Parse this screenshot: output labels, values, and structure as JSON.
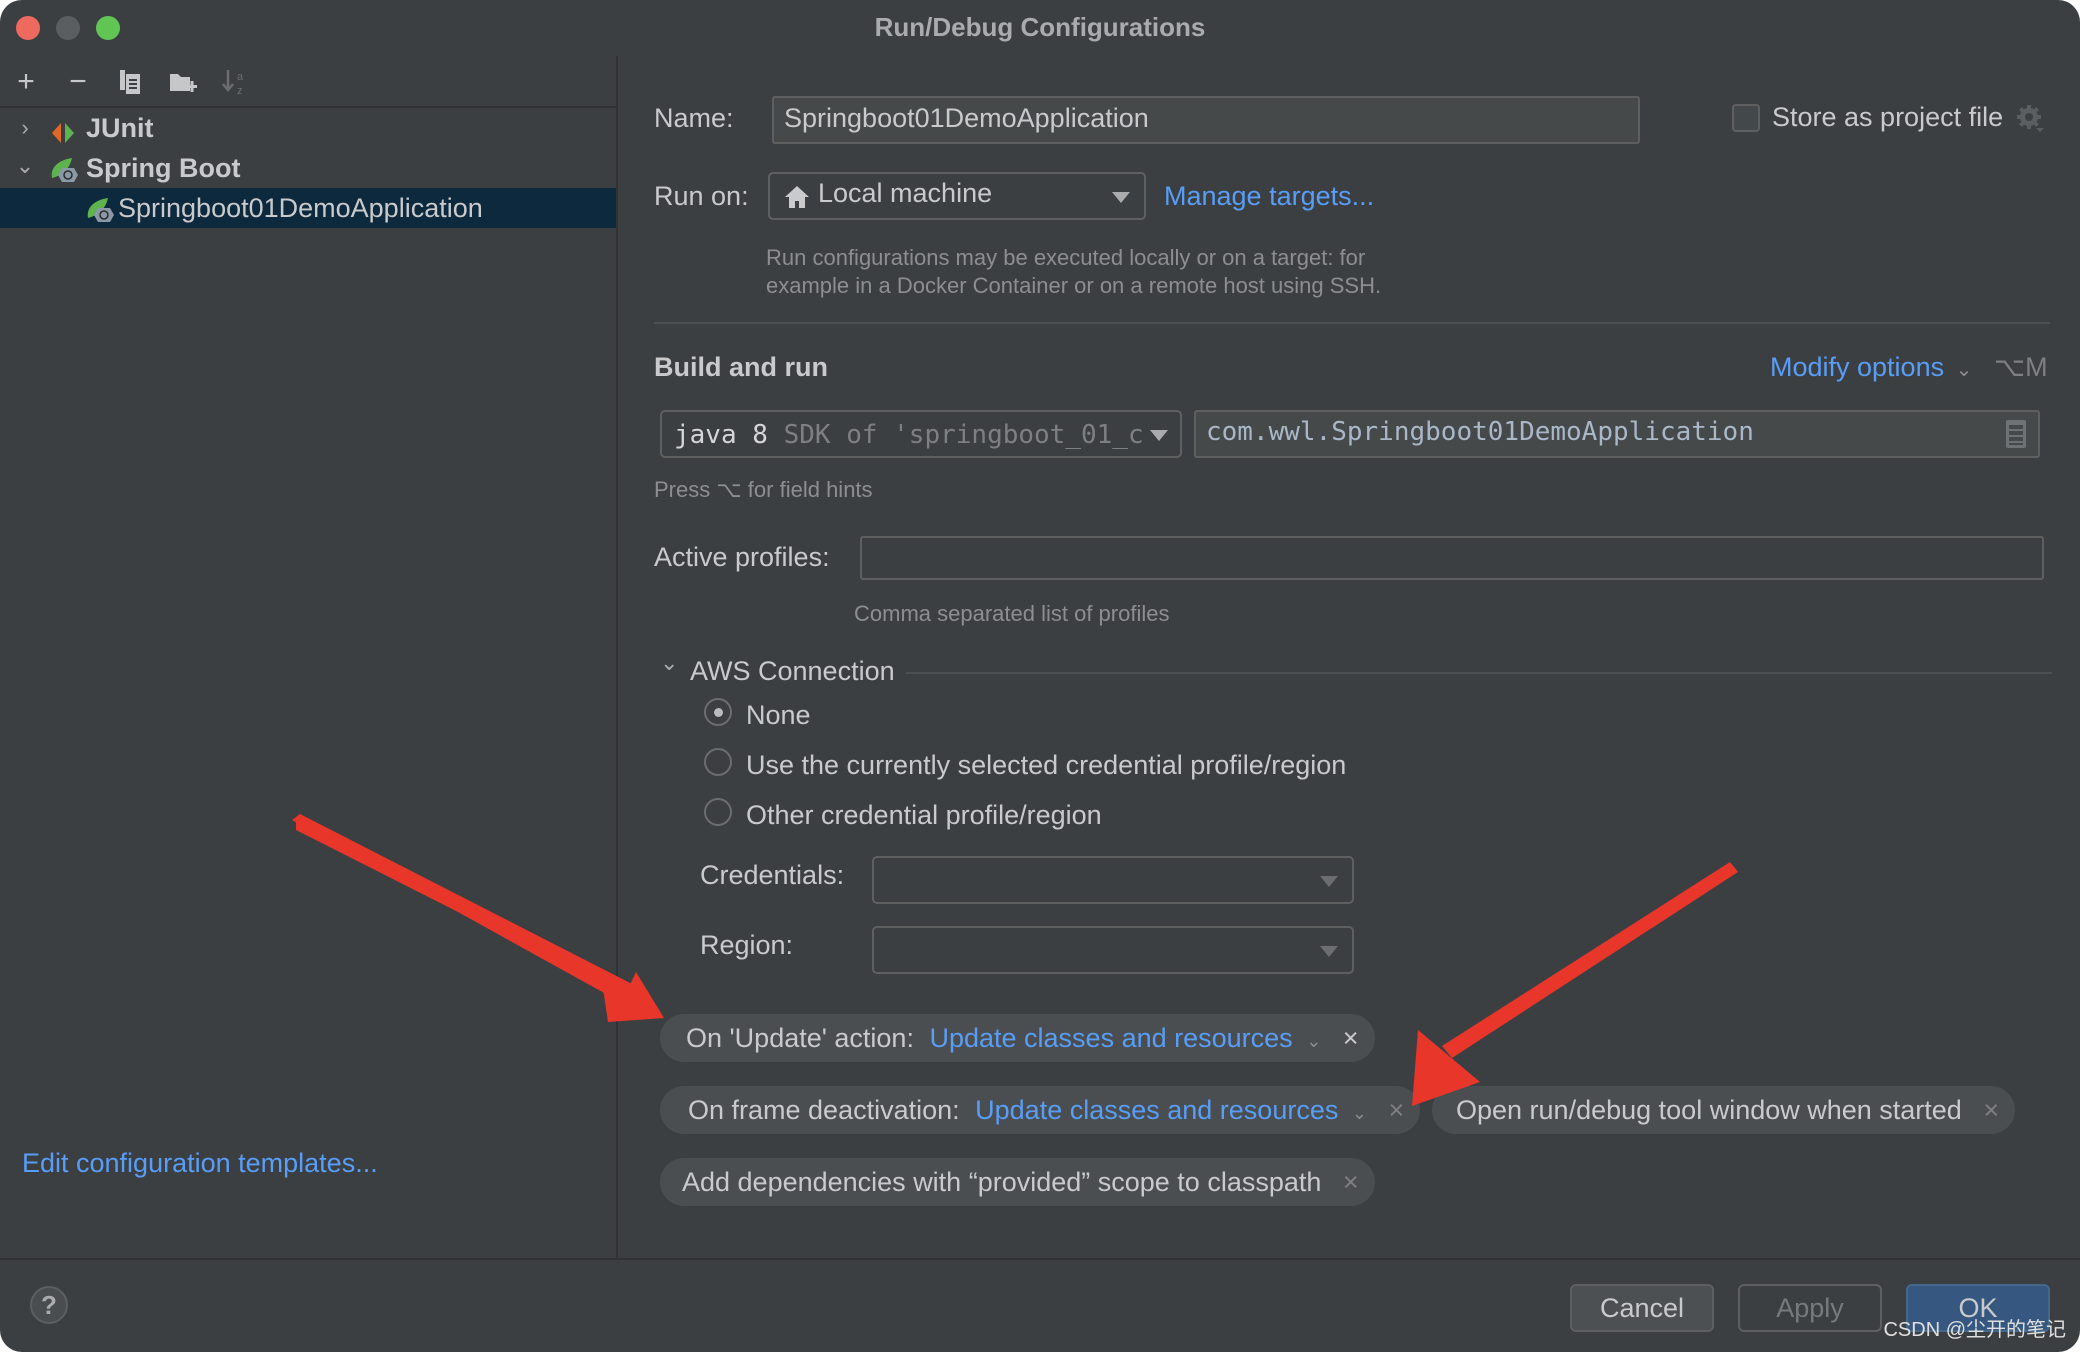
{
  "window": {
    "title": "Run/Debug Configurations",
    "traffic_lights": {
      "close": "#ee6a5f",
      "minimize": "#5b5e61",
      "maximize": "#61c554"
    }
  },
  "sidebar": {
    "toolbar": [
      {
        "icon": "plus-icon",
        "glyph": "+"
      },
      {
        "icon": "minus-icon",
        "glyph": "−"
      },
      {
        "icon": "copy-icon",
        "glyph": "⧉"
      },
      {
        "icon": "new-folder-icon",
        "glyph": "▰"
      },
      {
        "icon": "sort-alpha-icon",
        "glyph": "↓"
      }
    ],
    "tree": [
      {
        "label": "JUnit",
        "expanded": false,
        "icon": "junit-icon"
      },
      {
        "label": "Spring Boot",
        "expanded": true,
        "icon": "spring-boot-icon"
      },
      {
        "label": "Springboot01DemoApplication",
        "selected": true,
        "icon": "spring-boot-app-icon"
      }
    ],
    "edit_templates_link": "Edit configuration templates..."
  },
  "form": {
    "name_label": "Name:",
    "name_value": "Springboot01DemoApplication",
    "store_checkbox_label": "Store as project file",
    "store_checked": false,
    "run_on_label": "Run on:",
    "run_on_value": "Local machine",
    "manage_targets_link": "Manage targets...",
    "run_on_hint_1": "Run configurations may be executed locally or on a target: for",
    "run_on_hint_2": "example in a Docker Container or on a remote host using SSH.",
    "build_run_title": "Build and run",
    "modify_options_link": "Modify options",
    "modify_options_shortcut": "⌥M",
    "jdk_bold": "java 8",
    "jdk_rest": " SDK of 'springboot_01_c",
    "main_class_value": "com.wwl.Springboot01DemoApplication",
    "field_hint": "Press ⌥ for field hints",
    "active_profiles_label": "Active profiles:",
    "active_profiles_value": "",
    "active_profiles_hint": "Comma separated list of profiles",
    "aws_section_title": "AWS Connection",
    "aws_options": [
      {
        "label": "None",
        "selected": true
      },
      {
        "label": "Use the currently selected credential profile/region",
        "selected": false
      },
      {
        "label": "Other credential profile/region",
        "selected": false
      }
    ],
    "credentials_label": "Credentials:",
    "credentials_value": "",
    "region_label": "Region:",
    "region_value": ""
  },
  "chips": {
    "update_action_label": "On 'Update' action:",
    "update_action_value": "Update classes and resources",
    "frame_deactivation_label": "On frame deactivation:",
    "frame_deactivation_value": "Update classes and resources",
    "open_tool_window": "Open run/debug tool window when started",
    "add_dependencies": "Add dependencies with “provided” scope to classpath",
    "remove_glyph": "×"
  },
  "footer": {
    "help_glyph": "?",
    "cancel_label": "Cancel",
    "apply_label": "Apply",
    "ok_label": "OK",
    "watermark": "CSDN @尘开的笔记"
  },
  "colors": {
    "link": "#589df6",
    "selection": "#0d293e",
    "ok_button": "#365880",
    "annotation_arrow": "#e8362a"
  }
}
